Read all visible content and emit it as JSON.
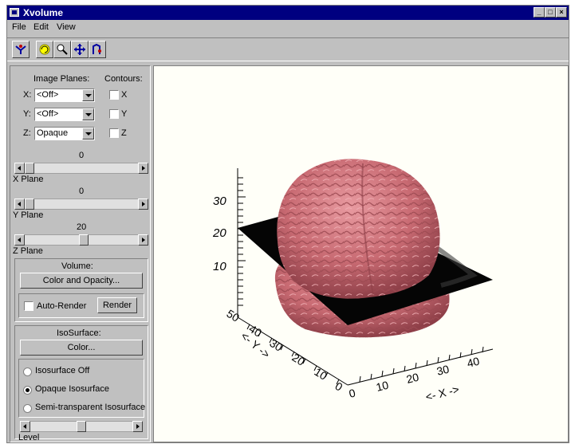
{
  "window": {
    "title": "Xvolume"
  },
  "menu": {
    "items": [
      "File",
      "Edit",
      "View"
    ]
  },
  "toolbar": {
    "tools": [
      "volume-icon",
      "rotate-icon",
      "zoom-icon",
      "pan-icon",
      "pick-icon"
    ]
  },
  "image_planes": {
    "header": "Image Planes:",
    "contours_header": "Contours:",
    "rows": [
      {
        "axis": "X:",
        "value": "<Off>",
        "contour": "X",
        "checked": false
      },
      {
        "axis": "Y:",
        "value": "<Off>",
        "contour": "Y",
        "checked": false
      },
      {
        "axis": "Z:",
        "value": "Opaque",
        "contour": "Z",
        "checked": false
      }
    ]
  },
  "sliders": {
    "x": {
      "value": "0",
      "label": "X Plane"
    },
    "y": {
      "value": "0",
      "label": "Y Plane"
    },
    "z": {
      "value": "20",
      "label": "Z Plane"
    },
    "level": {
      "label": "Level"
    }
  },
  "volume": {
    "header": "Volume:",
    "color_opacity": "Color and Opacity...",
    "auto_render": "Auto-Render",
    "render": "Render"
  },
  "isosurface": {
    "header": "IsoSurface:",
    "color": "Color...",
    "options": [
      {
        "label": "Isosurface Off",
        "selected": false
      },
      {
        "label": "Opaque Isosurface",
        "selected": true
      },
      {
        "label": "Semi-transparent Isosurface",
        "selected": false
      }
    ]
  },
  "plot": {
    "z_ticks": [
      "10",
      "20",
      "30"
    ],
    "y_ticks": [
      "0",
      "10",
      "20",
      "30",
      "40",
      "50"
    ],
    "x_ticks": [
      "0",
      "10",
      "20",
      "30",
      "40"
    ],
    "y_title": "<- Y ->",
    "x_title": "<- X ->"
  },
  "colors": {
    "titlebar": "#000080",
    "surface": "#c86a72",
    "panel": "#c0c0c0"
  }
}
